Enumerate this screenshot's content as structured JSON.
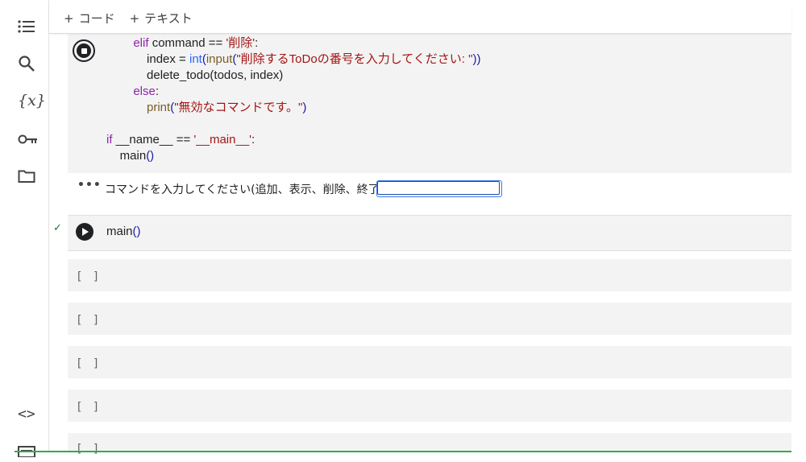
{
  "toolbar": {
    "add_code": "コード",
    "add_text": "テキスト"
  },
  "sidebar": {
    "items": [
      {
        "name": "table-of-contents-icon"
      },
      {
        "name": "search-icon"
      },
      {
        "name": "variables-icon",
        "label": "{x}"
      },
      {
        "name": "secrets-key-icon"
      },
      {
        "name": "files-folder-icon"
      },
      {
        "name": "code-snippets-icon",
        "label": "<>"
      },
      {
        "name": "terminal-icon"
      }
    ]
  },
  "code_cell_1": {
    "status": "running",
    "lines": [
      {
        "indent": "        ",
        "parts": [
          [
            "kw",
            "elif"
          ],
          [
            "t",
            " command == "
          ],
          [
            "str",
            "'削除'"
          ],
          [
            "t",
            ":"
          ]
        ]
      },
      {
        "indent": "            ",
        "parts": [
          [
            "t",
            "index = "
          ],
          [
            "bi",
            "int"
          ],
          [
            "paren",
            "("
          ],
          [
            "fn",
            "input"
          ],
          [
            "paren",
            "("
          ],
          [
            "str",
            "\"削除するToDoの番号を入力してください: \""
          ],
          [
            "paren",
            "))"
          ]
        ]
      },
      {
        "indent": "            ",
        "parts": [
          [
            "t",
            "delete_todo(todos, index)"
          ]
        ]
      },
      {
        "indent": "        ",
        "parts": [
          [
            "kw",
            "else"
          ],
          [
            "t",
            ":"
          ]
        ]
      },
      {
        "indent": "            ",
        "parts": [
          [
            "fn",
            "print"
          ],
          [
            "paren",
            "("
          ],
          [
            "str",
            "\"無効なコマンドです。\""
          ],
          [
            "paren",
            ")"
          ]
        ]
      },
      {
        "indent": "",
        "parts": []
      },
      {
        "indent": "",
        "parts": [
          [
            "kw",
            "if"
          ],
          [
            "t",
            " __name__ == "
          ],
          [
            "str",
            "'__main__'"
          ],
          [
            "t",
            ":"
          ]
        ]
      },
      {
        "indent": "    ",
        "parts": [
          [
            "t",
            "main"
          ],
          [
            "paren",
            "()"
          ]
        ]
      }
    ]
  },
  "output": {
    "dots": "•••",
    "prompt": "コマンドを入力してください(追加、表示、削除、終了):",
    "input_value": ""
  },
  "code_cell_2": {
    "status_check": "✓",
    "code_name": "main",
    "code_parens": "()"
  },
  "empty_cells": [
    {
      "label": "[ ]"
    },
    {
      "label": "[ ]"
    },
    {
      "label": "[ ]"
    },
    {
      "label": "[ ]"
    },
    {
      "label": "[ ]"
    }
  ],
  "colors": {
    "keyword": "#8e24aa",
    "string": "#a31515",
    "builtin": "#2962ff",
    "function": "#795e26",
    "success": "#137333",
    "input_border": "#1a4fa0"
  }
}
